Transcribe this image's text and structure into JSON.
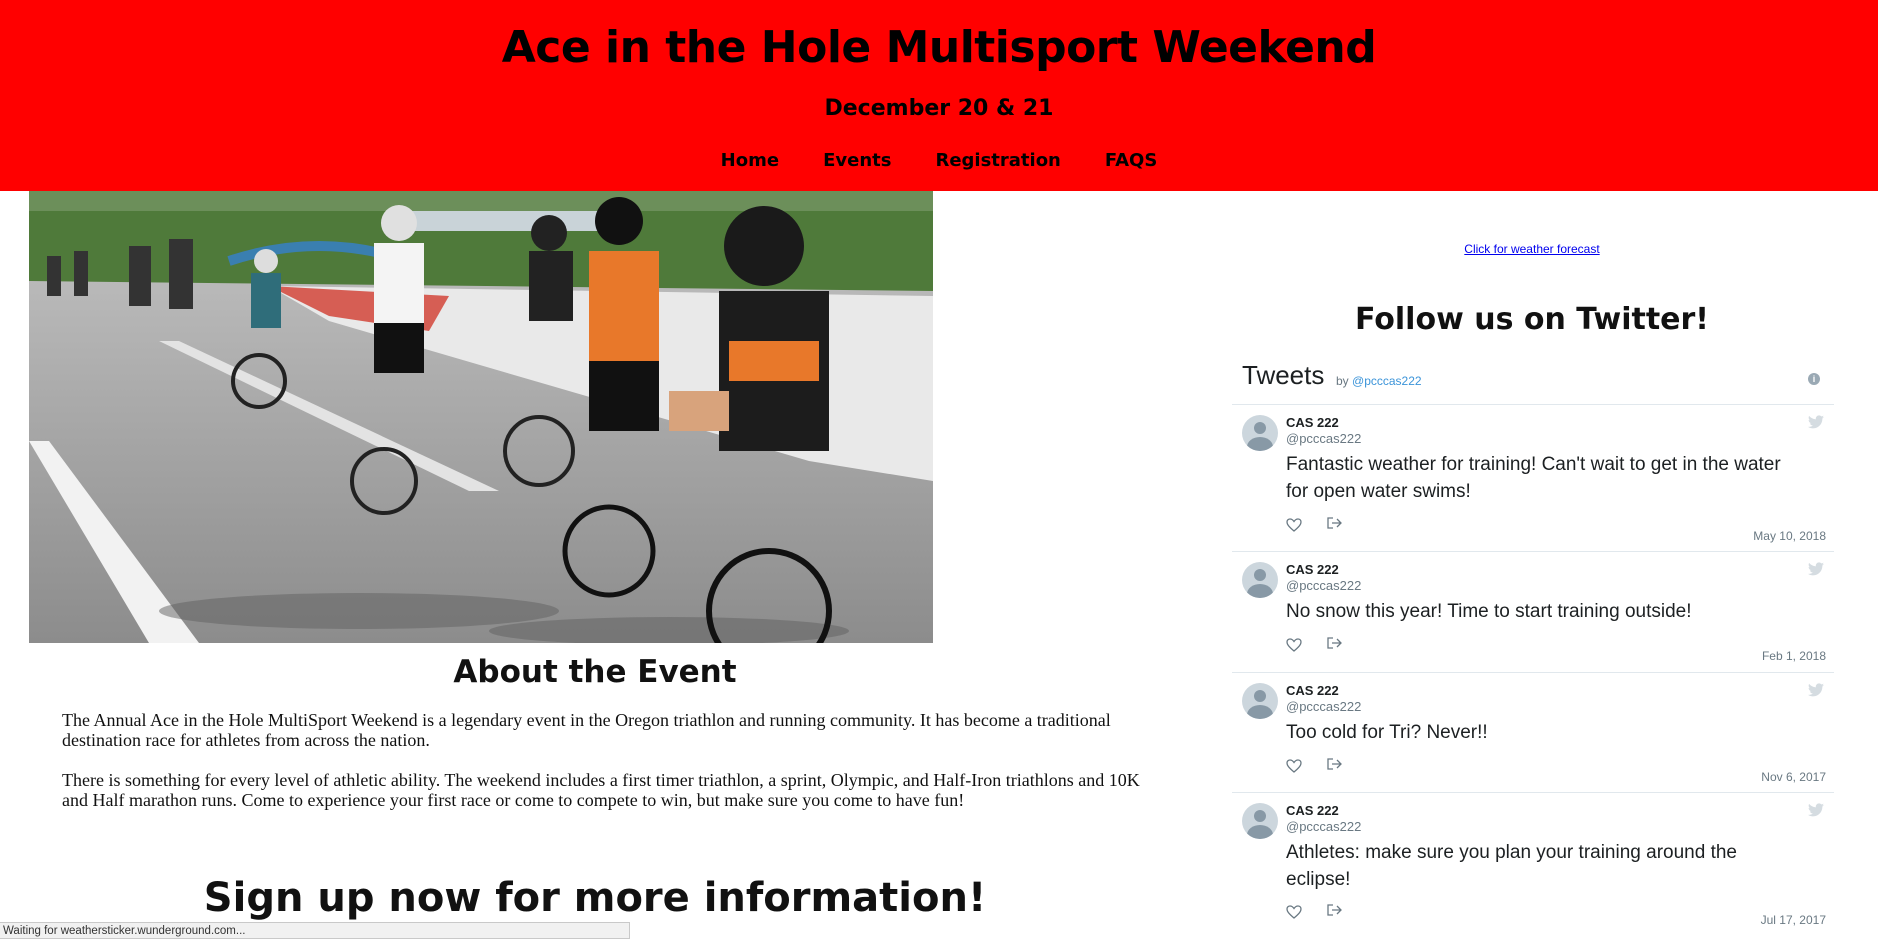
{
  "header": {
    "title": "Ace in the Hole Multisport Weekend",
    "date": "December 20 & 21",
    "nav": [
      "Home",
      "Events",
      "Registration",
      "FAQS"
    ]
  },
  "about": {
    "title": "About the Event",
    "p1": "The Annual Ace in the Hole MultiSport Weekend is a legendary event in the Oregon triathlon and running community. It has become a traditional destination race for athletes from across the nation.",
    "p2": "There is something for every level of athletic ability. The weekend includes a first timer triathlon, a sprint, Olympic, and Half-Iron triathlons and 10K and Half marathon runs. Come to experience your first race or come to compete to win, but make sure you come to have fun!"
  },
  "signup": {
    "title": "Sign up now for more information!"
  },
  "weather": {
    "link": "Click for weather forecast"
  },
  "twitter": {
    "heading": "Follow us on Twitter!",
    "timeline_title": "Tweets",
    "by": "by",
    "handle": "@pcccas222",
    "tweets": [
      {
        "name": "CAS 222",
        "handle": "@pcccas222",
        "text": "Fantastic weather for training! Can't wait to get in the water for open water swims!",
        "date": "May 10, 2018"
      },
      {
        "name": "CAS 222",
        "handle": "@pcccas222",
        "text": "No snow this year! Time to start training outside!",
        "date": "Feb 1, 2018"
      },
      {
        "name": "CAS 222",
        "handle": "@pcccas222",
        "text": "Too cold for Tri? Never!!",
        "date": "Nov 6, 2017"
      },
      {
        "name": "CAS 222",
        "handle": "@pcccas222",
        "text": "Athletes: make sure you plan your training around the eclipse!",
        "date": "Jul 17, 2017"
      }
    ]
  },
  "status": {
    "text": "Waiting for weathersticker.wunderground.com..."
  },
  "colors": {
    "header_bg": "#ff0000",
    "link": "#0000ee",
    "twitter_blue": "#3b94d9"
  },
  "icons": [
    "info-icon",
    "twitter-bird-icon",
    "heart-icon",
    "share-icon",
    "avatar"
  ]
}
